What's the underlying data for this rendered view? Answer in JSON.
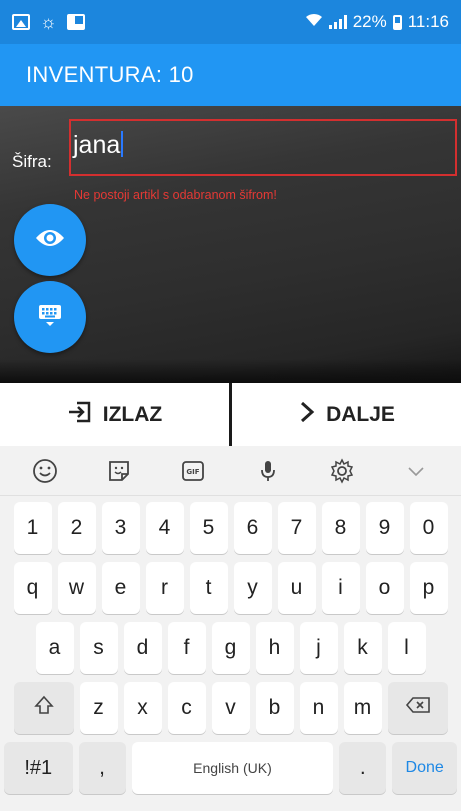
{
  "status_bar": {
    "battery": "22%",
    "time": "11:16"
  },
  "app_bar": {
    "title": "INVENTURA: 10"
  },
  "form": {
    "code_label": "Šifra:",
    "code_value": "jana",
    "error_message": "Ne postoji artikl s odabranom šifrom!"
  },
  "actions": {
    "exit_label": "IZLAZ",
    "next_label": "DALJE"
  },
  "keyboard": {
    "row1": [
      "1",
      "2",
      "3",
      "4",
      "5",
      "6",
      "7",
      "8",
      "9",
      "0"
    ],
    "row2": [
      "q",
      "w",
      "e",
      "r",
      "t",
      "y",
      "u",
      "i",
      "o",
      "p"
    ],
    "row3": [
      "a",
      "s",
      "d",
      "f",
      "g",
      "h",
      "j",
      "k",
      "l"
    ],
    "row4": [
      "z",
      "x",
      "c",
      "v",
      "b",
      "n",
      "m"
    ],
    "symbols_key": "!#1",
    "comma_key": ",",
    "space_label": "English (UK)",
    "period_key": ".",
    "done_key": "Done"
  }
}
